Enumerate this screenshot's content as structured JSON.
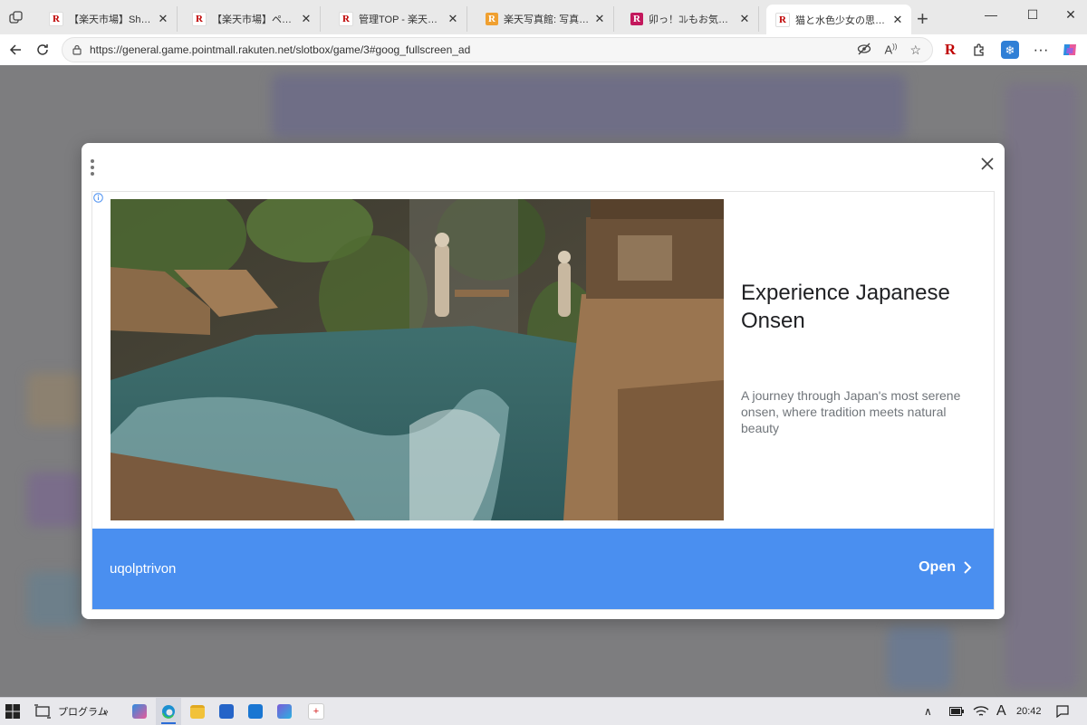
{
  "browser": {
    "tabs": [
      {
        "title": "【楽天市場】Shopping is",
        "favicon": "R",
        "favicon_style": "red",
        "active": false
      },
      {
        "title": "【楽天市場】ページ閲覧",
        "favicon": "R",
        "favicon_style": "red",
        "active": false
      },
      {
        "title": "管理TOP - 楽天ブログ",
        "favicon": "R",
        "favicon_style": "red",
        "active": false
      },
      {
        "title": "楽天写真館: 写真プリント",
        "favicon": "R",
        "favicon_style": "orange",
        "active": false
      },
      {
        "title": "卯っ！ｺﾚもお気軽に",
        "favicon": "R",
        "favicon_style": "pink",
        "active": false
      },
      {
        "title": "猫と水色少女の思い出",
        "favicon": "R",
        "favicon_style": "red",
        "active": true
      }
    ],
    "url": "https://general.game.pointmall.rakuten.net/slotbox/game/3#goog_fullscreen_ad"
  },
  "ad": {
    "headline": "Experience Japanese Onsen",
    "description": "A journey through Japan's most serene onsen, where tradition meets natural beauty",
    "advertiser": "uqolptrivon",
    "cta_label": "Open",
    "accent_color": "#4a8ff0"
  },
  "taskbar": {
    "program_label": "プログラム",
    "ime_label": "A",
    "clock": "20:42"
  }
}
